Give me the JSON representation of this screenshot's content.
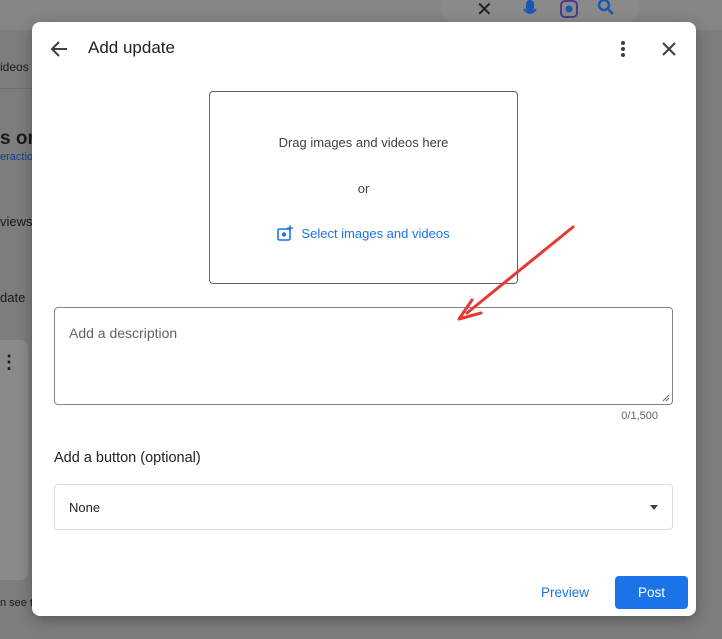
{
  "background": {
    "tab_fragment": "ideos",
    "heading_fragment": "s on",
    "link_fragment": "eraction",
    "item1_fragment": "views",
    "item2_fragment": "date",
    "footer_fragment": "n see t"
  },
  "dialog": {
    "title": "Add update",
    "back_icon": "arrow-back-icon",
    "more_icon": "more-vert-icon",
    "close_icon": "close-icon"
  },
  "media": {
    "drag_text": "Drag images and videos here",
    "or_text": "or",
    "select_label": "Select images and videos",
    "select_icon": "add-photo-icon"
  },
  "description": {
    "placeholder": "Add a description",
    "value": "",
    "counter": "0/1,500"
  },
  "button_section": {
    "label": "Add a button (optional)",
    "selected": "None"
  },
  "actions": {
    "preview_label": "Preview",
    "post_label": "Post"
  },
  "colors": {
    "accent": "#1a73e8",
    "annotation_arrow": "#e53935"
  }
}
